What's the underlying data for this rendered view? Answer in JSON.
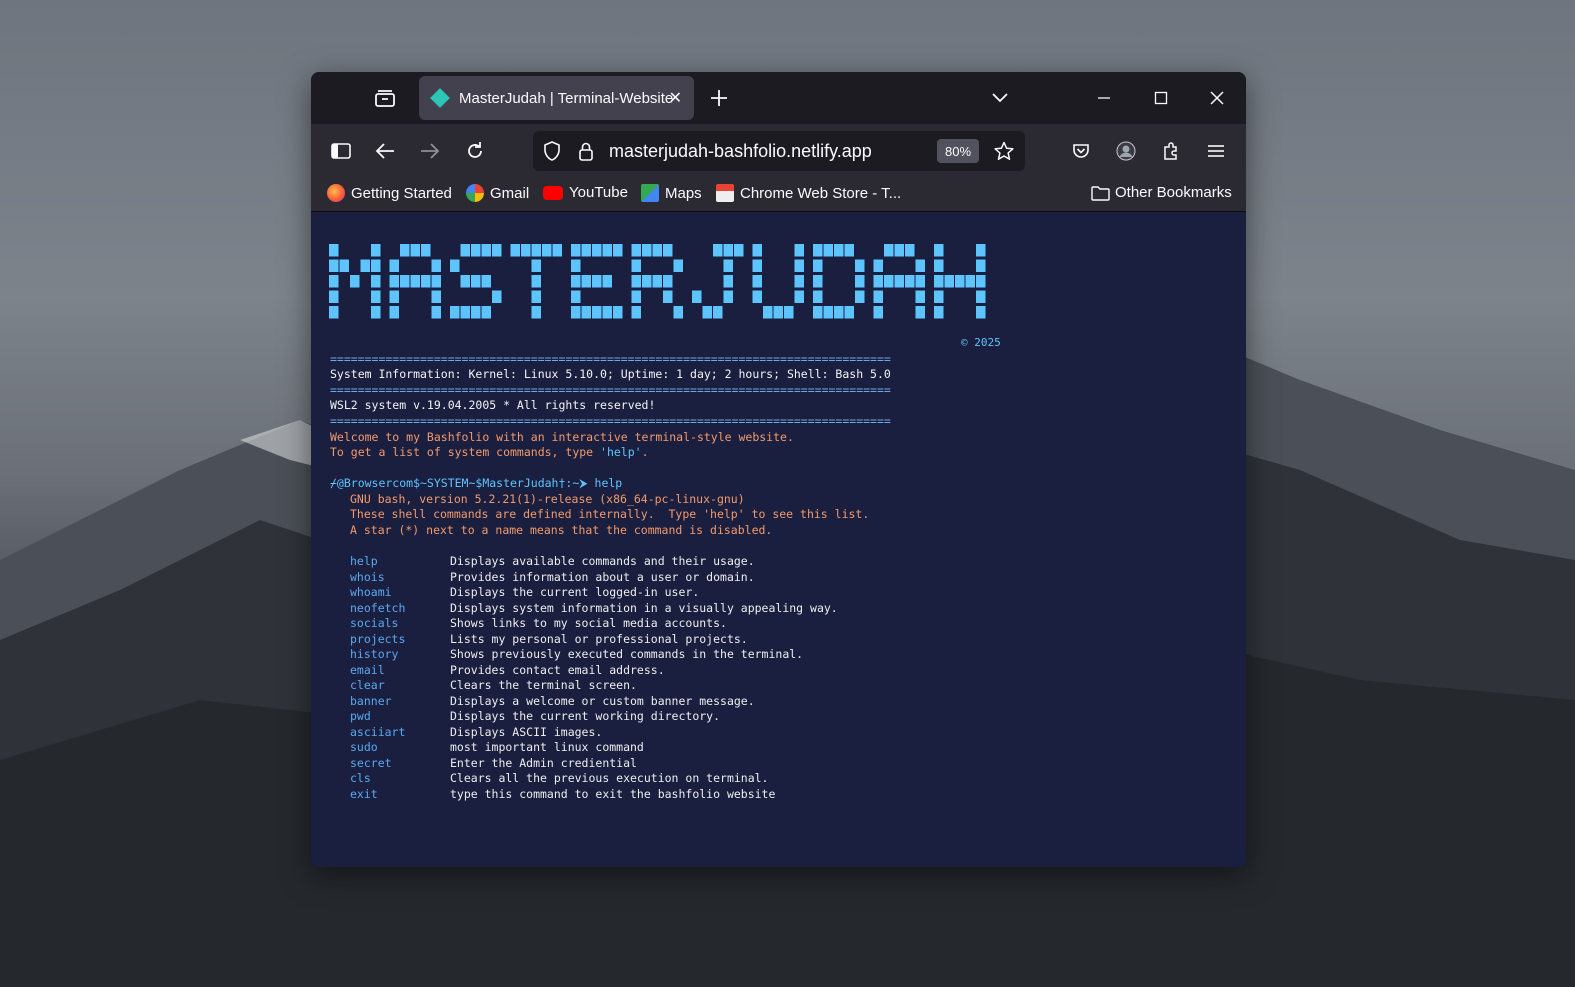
{
  "browser": {
    "tab_title": "MasterJudah | Terminal-Website",
    "url": "masterjudah-bashfolio.netlify.app",
    "zoom": "80%"
  },
  "bookmarks": [
    {
      "label": "Getting Started"
    },
    {
      "label": "Gmail"
    },
    {
      "label": "YouTube"
    },
    {
      "label": "Maps"
    },
    {
      "label": "Chrome Web Store - T..."
    }
  ],
  "other_bookmarks": "Other Bookmarks",
  "terminal": {
    "copyright": "© 2025",
    "separator": "=================================================================================",
    "system_info": "System Information: Kernel: Linux 5.10.0; Uptime: 1 day; 2 hours; Shell: Bash 5.0",
    "rights": "WSL2 system v.19.04.2005 * All rights reserved!",
    "welcome_line1": "Welcome to my Bashfolio with an interactive terminal-style website.",
    "welcome_line2_prefix": "To get a list of system commands, type ",
    "welcome_line2_cmd": "'help'",
    "welcome_line2_suffix": ".",
    "prompt": "⌿@Browsercom$~SYSTEM~$MasterJudah†:~⮞",
    "typed_command": "help",
    "help_line1": "GNU bash, version 5.2.21(1)-release (x86_64-pc-linux-gnu)",
    "help_line2": "These shell commands are defined internally.  Type 'help' to see this list.",
    "help_line3": "A star (*) next to a name means that the command is disabled.",
    "commands": [
      {
        "name": "help",
        "desc": "Displays available commands and their usage."
      },
      {
        "name": "whois",
        "desc": "Provides information about a user or domain."
      },
      {
        "name": "whoami",
        "desc": "Displays the current logged-in user."
      },
      {
        "name": "neofetch",
        "desc": "Displays system information in a visually appealing way."
      },
      {
        "name": "socials",
        "desc": "Shows links to my social media accounts."
      },
      {
        "name": "projects",
        "desc": "Lists my personal or professional projects."
      },
      {
        "name": "history",
        "desc": "Shows previously executed commands in the terminal."
      },
      {
        "name": "email",
        "desc": "Provides contact email address."
      },
      {
        "name": "clear",
        "desc": "Clears the terminal screen."
      },
      {
        "name": "banner",
        "desc": "Displays a welcome or custom banner message."
      },
      {
        "name": "pwd",
        "desc": "Displays the current working directory."
      },
      {
        "name": "asciiart",
        "desc": "Displays ASCII images."
      },
      {
        "name": "sudo",
        "desc": "most important linux command"
      },
      {
        "name": "secret",
        "desc": "Enter the Admin crediential"
      },
      {
        "name": "cls",
        "desc": "Clears all the previous execution on terminal."
      },
      {
        "name": "exit",
        "desc": "type this command to exit the bashfolio website"
      }
    ],
    "banner_text": "MASTERJUDAH"
  },
  "colors": {
    "terminal_bg": "#1a1f3f",
    "accent_blue": "#5ec4ff",
    "prompt_orange": "#f29a6c"
  }
}
